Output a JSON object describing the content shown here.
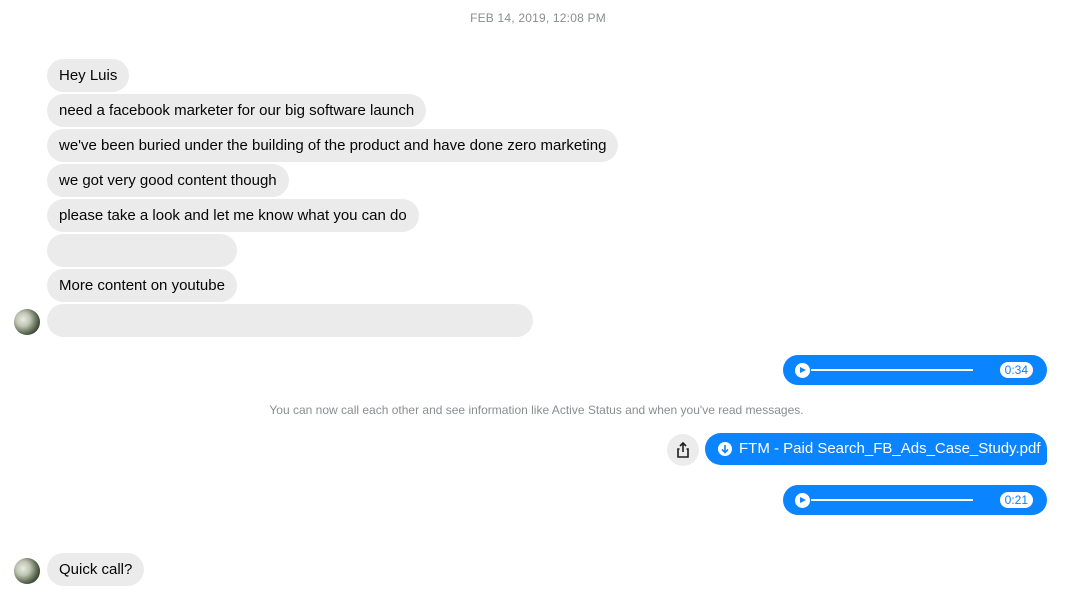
{
  "conversation": {
    "timestamp": "FEB 14, 2019, 12:08 PM",
    "incoming_messages": [
      "Hey Luis",
      "need a facebook marketer for our big software launch",
      "we've been buried under the building of the product and have done zero marketing",
      "we got very good content though",
      "please take a look and let me know what you can do",
      "",
      "More content on youtube",
      ""
    ],
    "notice": "You can now call each other and see information like Active Status and when you've read messages.",
    "outgoing": {
      "audio_1_duration": "0:34",
      "attachment_name": "FTM - Paid Search_FB_Ads_Case_Study.pdf",
      "audio_2_duration": "0:21"
    },
    "last_incoming": "Quick call?"
  },
  "icons": [
    "play-icon",
    "download-icon",
    "share-icon",
    "avatar"
  ],
  "colors": {
    "outgoing_bubble": "#0a84ff",
    "incoming_bubble": "#ebebeb",
    "meta_text": "#8a8d91"
  }
}
